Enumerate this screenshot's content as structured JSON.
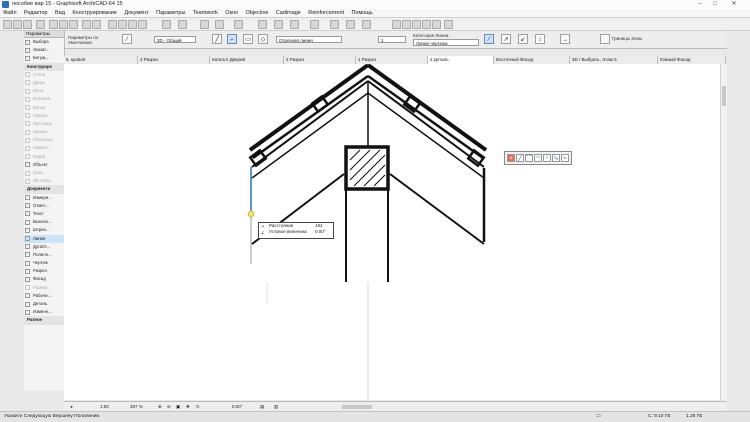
{
  "window": {
    "title": "пособие вар 15 - Graphisoft ArchiCAD-64 15",
    "minimize": "–",
    "maximize": "□",
    "close": "✕"
  },
  "menu": [
    "Файл",
    "Редактор",
    "Вид",
    "Конструирование",
    "Документ",
    "Параметры",
    "Teamwork",
    "Окно",
    "Objective",
    "Cadimage",
    "Reinforcement",
    "Помощь"
  ],
  "infobox": {
    "params_label": "Параметры по Умолчанию",
    "layer_value": "3D - Общий",
    "line_type": "Отрезная линия",
    "pen_value": "1",
    "line_category_label": "Категория Линии:",
    "line_category_value": "Линии чертежа",
    "zones_border_label": "Границы Зоны"
  },
  "palette": {
    "title": "Параметры",
    "items": [
      {
        "label": "Выбора",
        "state": "normal"
      },
      {
        "label": "Указат...",
        "state": "normal"
      },
      {
        "label": "Бегущ...",
        "state": "normal"
      },
      {
        "label": "Конструиро",
        "state": "group"
      },
      {
        "label": "Стена",
        "state": "disabled"
      },
      {
        "label": "Дверь",
        "state": "disabled"
      },
      {
        "label": "Окно",
        "state": "disabled"
      },
      {
        "label": "Колонна",
        "state": "disabled"
      },
      {
        "label": "Балка",
        "state": "disabled"
      },
      {
        "label": "Перекр.",
        "state": "disabled"
      },
      {
        "label": "Лестница",
        "state": "disabled"
      },
      {
        "label": "Крыша",
        "state": "disabled"
      },
      {
        "label": "Оболочка",
        "state": "disabled"
      },
      {
        "label": "Навесн...",
        "state": "disabled"
      },
      {
        "label": "Морф",
        "state": "disabled"
      },
      {
        "label": "Объект",
        "state": "normal"
      },
      {
        "label": "Зона",
        "state": "disabled"
      },
      {
        "label": "3D-сетка",
        "state": "disabled"
      },
      {
        "label": "Документи",
        "state": "group"
      },
      {
        "label": "Измери...",
        "state": "normal"
      },
      {
        "label": "Отмет...",
        "state": "normal"
      },
      {
        "label": "Текст",
        "state": "normal"
      },
      {
        "label": "Выноск...",
        "state": "normal"
      },
      {
        "label": "Штрих...",
        "state": "normal"
      },
      {
        "label": "Линия",
        "state": "selected"
      },
      {
        "label": "Дуга/О...",
        "state": "normal"
      },
      {
        "label": "Полило...",
        "state": "normal"
      },
      {
        "label": "Чертеж",
        "state": "normal"
      },
      {
        "label": "Разрез",
        "state": "normal"
      },
      {
        "label": "Фасад",
        "state": "normal"
      },
      {
        "label": "Развер...",
        "state": "disabled"
      },
      {
        "label": "Рабочи...",
        "state": "normal"
      },
      {
        "label": "Деталь",
        "state": "normal"
      },
      {
        "label": "Измене...",
        "state": "normal"
      },
      {
        "label": "Разное",
        "state": "group"
      }
    ]
  },
  "tabs": [
    {
      "label": "5. кровля",
      "active": false
    },
    {
      "label": "3 Разрез",
      "active": false
    },
    {
      "label": "Каталог Дверей",
      "active": false
    },
    {
      "label": "2 Разрез",
      "active": false
    },
    {
      "label": "1 Разрез",
      "active": false
    },
    {
      "label": "2 Деталь",
      "active": true
    },
    {
      "label": "Восточный Фасад",
      "active": false
    },
    {
      "label": "3D / Выбрать, Этаж 5",
      "active": false
    },
    {
      "label": "Южный Фасад",
      "active": false
    }
  ],
  "tracker": {
    "distance_label": "Расстояние",
    "distance_value": "184",
    "angle_label": "Угловое величина",
    "angle_value": "0.00°"
  },
  "bottombar": {
    "scale": "1:50",
    "zoom": "397 %",
    "angle": "0.00°"
  },
  "status": {
    "prompt": "Укажите Следующую Вершину Полилинии.",
    "disk_a": "С: 9.10 ГБ",
    "disk_b": "1.28 ГБ"
  },
  "colors": {
    "accent": "#2f6fb5",
    "selection": "#cde3f8"
  }
}
